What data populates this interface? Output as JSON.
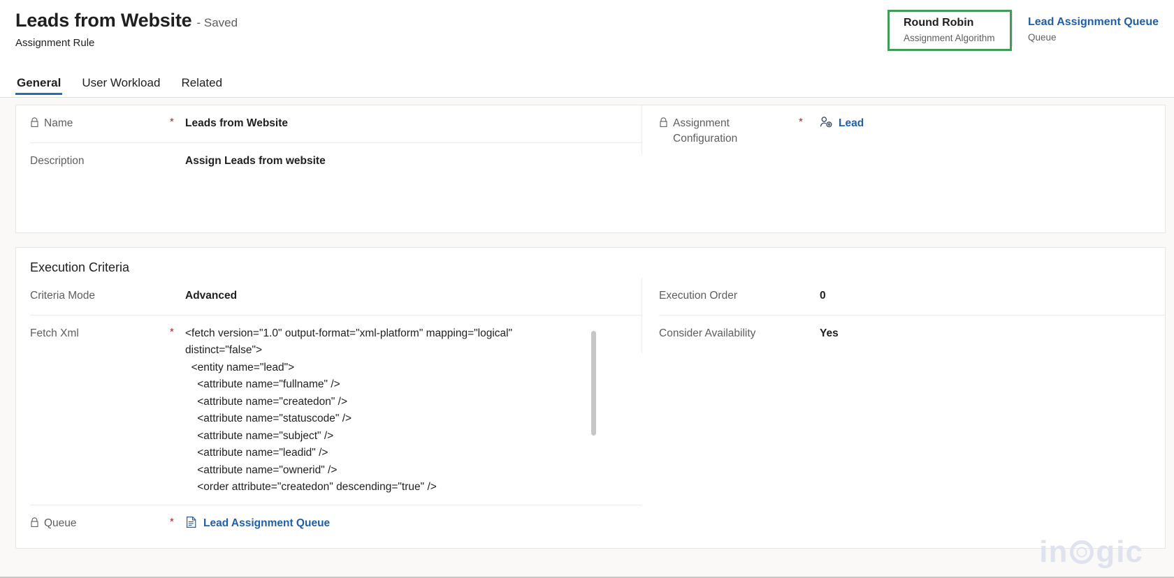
{
  "header": {
    "title": "Leads from Website",
    "saved_status": "- Saved",
    "entity_name": "Assignment Rule",
    "pills": [
      {
        "value": "Round Robin",
        "label": "Assignment Algorithm",
        "highlighted": true,
        "is_link": false
      },
      {
        "value": "Lead Assignment Queue",
        "label": "Queue",
        "highlighted": false,
        "is_link": true
      }
    ],
    "tabs": [
      {
        "label": "General",
        "active": true
      },
      {
        "label": "User Workload",
        "active": false
      },
      {
        "label": "Related",
        "active": false
      }
    ]
  },
  "general_section": {
    "name": {
      "label": "Name",
      "required": "*",
      "value": "Leads from Website",
      "locked": true
    },
    "description": {
      "label": "Description",
      "required": "",
      "value": "Assign Leads from website",
      "locked": false
    },
    "assignment_configuration": {
      "label": "Assignment Configuration",
      "required": "*",
      "value": "Lead",
      "locked": true,
      "icon": "lead-lookup-icon"
    }
  },
  "execution_criteria": {
    "title": "Execution Criteria",
    "criteria_mode": {
      "label": "Criteria Mode",
      "required": "",
      "value": "Advanced"
    },
    "fetch_xml": {
      "label": "Fetch Xml",
      "required": "*",
      "value": "<fetch version=\"1.0\" output-format=\"xml-platform\" mapping=\"logical\" distinct=\"false\">\n  <entity name=\"lead\">\n    <attribute name=\"fullname\" />\n    <attribute name=\"createdon\" />\n    <attribute name=\"statuscode\" />\n    <attribute name=\"subject\" />\n    <attribute name=\"leadid\" />\n    <attribute name=\"ownerid\" />\n    <order attribute=\"createdon\" descending=\"true\" />"
    },
    "execution_order": {
      "label": "Execution Order",
      "required": "",
      "value": "0"
    },
    "consider_availability": {
      "label": "Consider Availability",
      "required": "",
      "value": "Yes"
    },
    "queue": {
      "label": "Queue",
      "required": "*",
      "value": "Lead Assignment Queue",
      "locked": true,
      "icon": "queue-lookup-icon"
    }
  },
  "watermark": {
    "part1": "in",
    "part2": "g",
    "part3": "ic"
  },
  "colors": {
    "highlight_border": "#3f9c5a",
    "link": "#1f5faa",
    "required": "#a4262c",
    "tab_underline": "#2b6cb0",
    "body_bg": "#faf9f8",
    "watermark": "#dfe3ef"
  }
}
